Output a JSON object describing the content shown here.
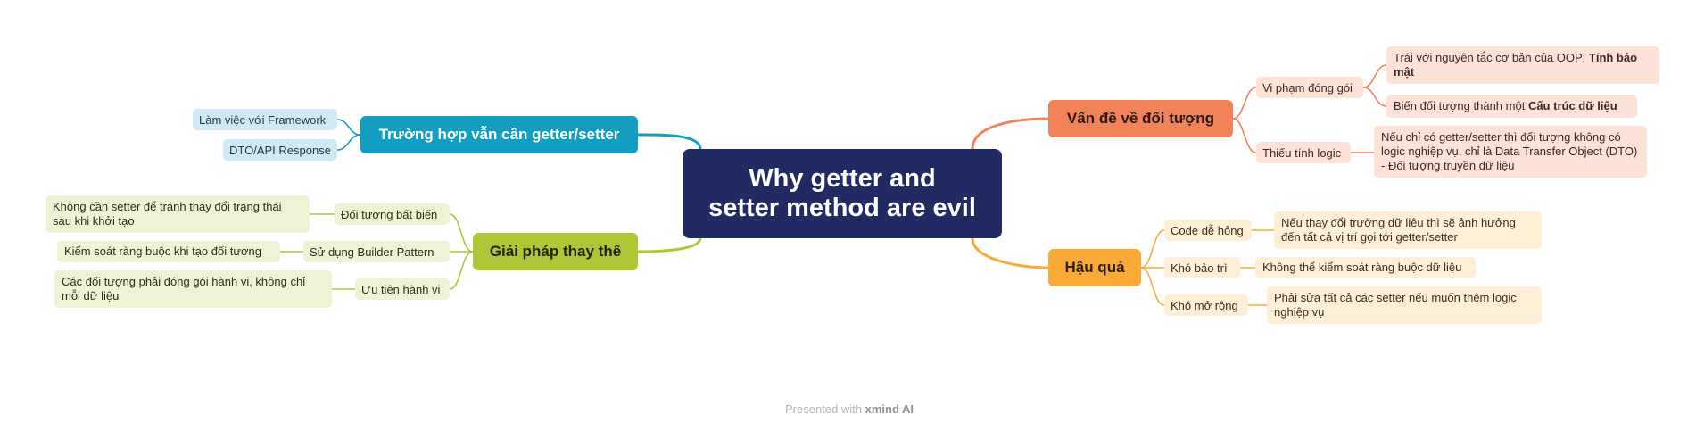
{
  "colors": {
    "root": "#212a62",
    "orange": "#f28257",
    "amber": "#fbab35",
    "teal": "#119ec1",
    "lime": "#afc636"
  },
  "root": {
    "line1": "Why getter and",
    "line2": "setter method are evil"
  },
  "branches": {
    "issues": {
      "label": "Vấn đề về đối tượng",
      "encapsulation": {
        "label": "Vi phạm đóng gói",
        "leaf1_text": "Trái với nguyên tắc cơ bản của OOP: ",
        "leaf1_bold": "Tính bảo mật",
        "leaf2_text": "Biến đối tượng thành một ",
        "leaf2_bold": "Cấu trúc dữ liệu"
      },
      "logic": {
        "label": "Thiếu tính logic",
        "leaf": "Nếu chỉ có getter/setter thì đối tượng không có logic nghiệp vụ, chỉ là Data Transfer Object (DTO) - Đối tượng truyền dữ liệu"
      }
    },
    "consequences": {
      "label": "Hậu quả",
      "items": [
        {
          "label": "Code dễ hỏng",
          "leaf": "Nếu thay đổi trường dữ liệu thì sẽ ảnh hưởng đến tất cả vị trí gọi tới getter/setter"
        },
        {
          "label": "Khó bảo trì",
          "leaf": "Không thể kiểm soát ràng buộc dữ liệu"
        },
        {
          "label": "Khó mở rộng",
          "leaf": "Phải sửa tất cả các setter nếu muốn thêm logic nghiệp vụ"
        }
      ]
    },
    "exceptions": {
      "label": "Trường hợp vẫn cần getter/setter",
      "items": [
        "Làm việc với Framework",
        "DTO/API Response"
      ]
    },
    "alternatives": {
      "label": "Giải pháp thay thế",
      "items": [
        {
          "label": "Đối tượng bất biến",
          "leaf": "Không cần setter để tránh thay đổi trạng thái sau khi khởi tạo"
        },
        {
          "label": "Sử dụng Builder Pattern",
          "leaf": "Kiểm soát ràng buộc khi tạo đối tượng"
        },
        {
          "label": "Ưu tiên hành vi",
          "leaf": "Các đối tượng phải đóng gói hành vi, không chỉ mỗi dữ liệu"
        }
      ]
    }
  },
  "footer": {
    "prefix": "Presented with ",
    "brand": "xmind AI"
  }
}
